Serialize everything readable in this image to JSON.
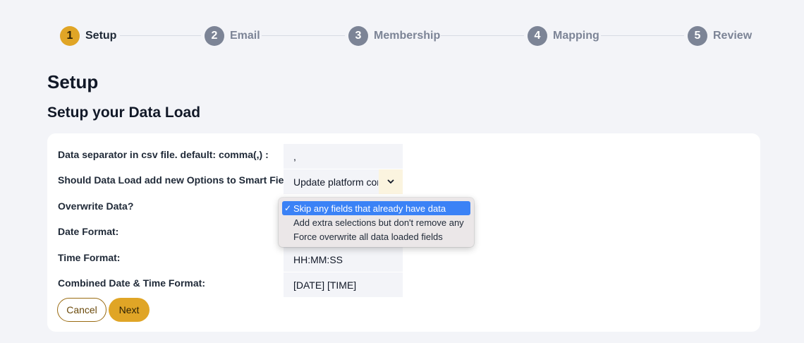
{
  "stepper": {
    "steps": [
      {
        "number": "1",
        "label": "Setup",
        "active": true
      },
      {
        "number": "2",
        "label": "Email",
        "active": false
      },
      {
        "number": "3",
        "label": "Membership",
        "active": false
      },
      {
        "number": "4",
        "label": "Mapping",
        "active": false
      },
      {
        "number": "5",
        "label": "Review",
        "active": false
      }
    ]
  },
  "page": {
    "title": "Setup",
    "section_title": "Setup your Data Load"
  },
  "form": {
    "separator": {
      "label": "Data separator in csv file. default: comma(,) :",
      "value": ","
    },
    "smart_fields": {
      "label": "Should Data Load add new Options to Smart Fields?",
      "value": "Update platform con"
    },
    "overwrite": {
      "label": "Overwrite Data?"
    },
    "date_format": {
      "label": "Date Format:"
    },
    "time_format": {
      "label": "Time Format:",
      "value": "HH:MM:SS"
    },
    "combined_format": {
      "label": "Combined Date & Time Format:",
      "value": "[DATE] [TIME]"
    }
  },
  "buttons": {
    "cancel": "Cancel",
    "next": "Next"
  },
  "overwrite_menu": {
    "check_mark": "✓",
    "options": [
      "Skip any fields that already have data",
      "Add extra selections but don't remove any",
      "Force overwrite all data loaded fields"
    ]
  },
  "colors": {
    "accent": "#e0a526",
    "inactive_step": "#7c8496",
    "menu_highlight": "#3b82f6"
  }
}
